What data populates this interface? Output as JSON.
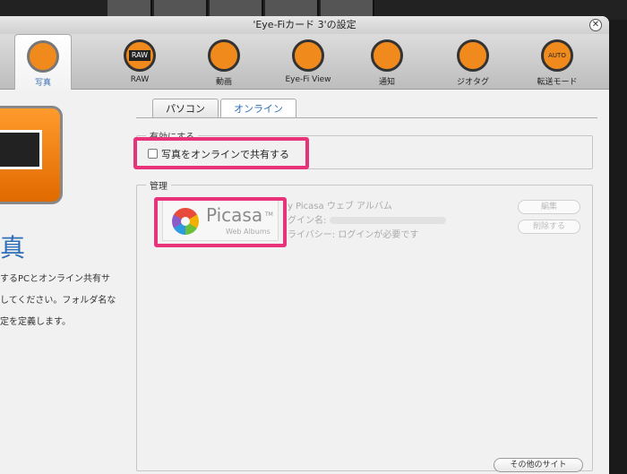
{
  "window": {
    "title": "'Eye-Fiカード 3'の設定",
    "close_glyph": "✕"
  },
  "toolbar": {
    "items": [
      {
        "label": "写真",
        "icon": "photo-icon",
        "active": true
      },
      {
        "label": "RAW",
        "icon": "raw-icon",
        "icon_text": "RAW"
      },
      {
        "label": "動画",
        "icon": "film-reel-icon"
      },
      {
        "label": "Eye-Fi View",
        "icon": "binoculars-icon"
      },
      {
        "label": "通知",
        "icon": "bell-icon"
      },
      {
        "label": "ジオタグ",
        "icon": "geotag-icon"
      },
      {
        "label": "転送モード",
        "icon": "transfer-mode-icon",
        "icon_text": "AUTO"
      }
    ]
  },
  "left_panel": {
    "title": "真",
    "description_lines": [
      "するPCとオンライン共有サ",
      "してください。フォルダ名な",
      "定を定義します。"
    ]
  },
  "tabs": [
    {
      "label": "パソコン",
      "active": false
    },
    {
      "label": "オンライン",
      "active": true
    }
  ],
  "enable_group": {
    "legend": "有効にする",
    "checkbox_label": "写真をオンラインで共有する",
    "checked": false
  },
  "manage_group": {
    "legend": "管理",
    "service": {
      "logo_word": "Picasa",
      "logo_tm": "TM",
      "logo_sub": "Web Albums",
      "name_line": "y Picasa ウェブ アルバム",
      "login_line": "グイン名:",
      "privacy_line": "ライバシー: ログインが必要です"
    },
    "edit_label": "編集",
    "delete_label": "削除する",
    "other_sites_label": "その他のサイト"
  },
  "colors": {
    "highlight": "#e8337a",
    "accent": "#2e6eb8",
    "orange": "#f08a1c"
  }
}
